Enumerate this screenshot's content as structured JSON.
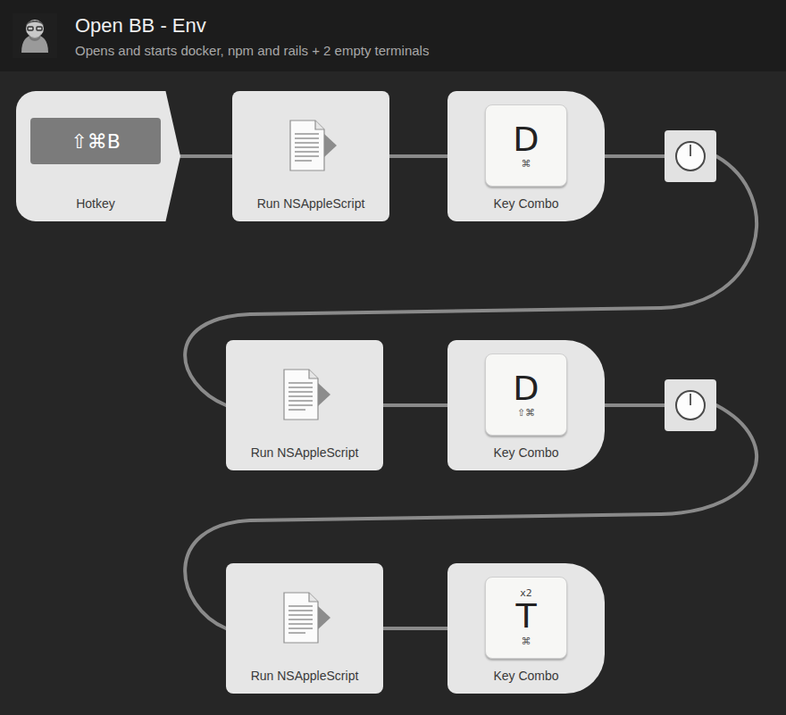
{
  "header": {
    "title": "Open BB - Env",
    "subtitle": "Opens and starts docker, npm and rails + 2 empty terminals"
  },
  "rows": [
    [
      {
        "kind": "hotkey",
        "label": "Hotkey",
        "keys": "⇧⌘B"
      },
      {
        "kind": "script",
        "label": "Run NSAppleScript"
      },
      {
        "kind": "keycombo",
        "label": "Key Combo",
        "key": "D",
        "modifiers": "⌘",
        "repeat": ""
      },
      {
        "kind": "delay"
      }
    ],
    [
      {
        "kind": "script",
        "label": "Run NSAppleScript"
      },
      {
        "kind": "keycombo",
        "label": "Key Combo",
        "key": "D",
        "modifiers": "⇧⌘",
        "repeat": ""
      },
      {
        "kind": "delay"
      }
    ],
    [
      {
        "kind": "script",
        "label": "Run NSAppleScript"
      },
      {
        "kind": "keycombo",
        "label": "Key Combo",
        "key": "T",
        "modifiers": "⌘",
        "repeat": "x2"
      }
    ]
  ]
}
